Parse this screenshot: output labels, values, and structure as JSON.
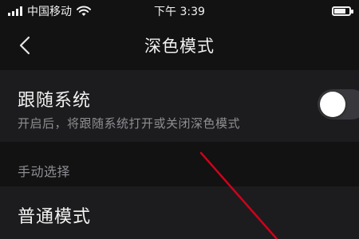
{
  "status_bar": {
    "carrier": "中国移动",
    "time": "下午 3:39"
  },
  "nav": {
    "title": "深色模式",
    "back_icon": "chevron-left-icon"
  },
  "follow_system": {
    "title": "跟随系统",
    "subtitle": "开启后，将跟随系统打开或关闭深色模式",
    "toggle_on": false
  },
  "manual": {
    "section_header": "手动选择",
    "normal_mode": "普通模式"
  },
  "colors": {
    "background": "#121212",
    "row_background": "#1c1c1e",
    "secondary_text": "#8e8e93",
    "annotation_arrow": "#d0021b"
  }
}
